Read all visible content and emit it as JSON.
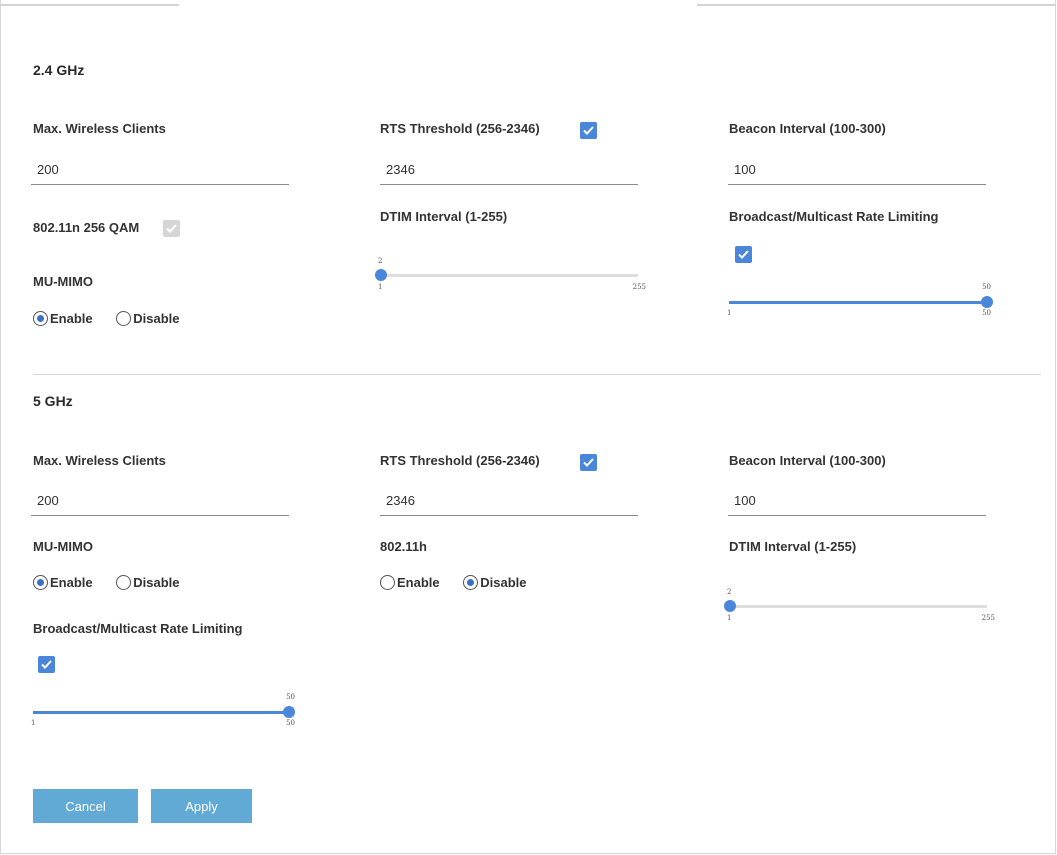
{
  "sections": {
    "ghz24": {
      "title": "2.4 GHz",
      "max_clients": {
        "label": "Max. Wireless Clients",
        "value": "200"
      },
      "rts": {
        "label": "RTS Threshold (256-2346)",
        "value": "2346",
        "checked": true
      },
      "beacon": {
        "label": "Beacon Interval (100-300)",
        "value": "100"
      },
      "qam": {
        "label": "802.11n 256 QAM",
        "checked": true,
        "disabled": true
      },
      "dtim": {
        "label": "DTIM Interval (1-255)",
        "value": "2",
        "min": "1",
        "max": "255"
      },
      "bm_rate": {
        "label": "Broadcast/Multicast Rate Limiting",
        "checked": true,
        "value": "50",
        "min": "1",
        "max": "50"
      },
      "mumimo": {
        "label": "MU-MIMO",
        "options": [
          "Enable",
          "Disable"
        ],
        "selected": "Enable"
      }
    },
    "ghz5": {
      "title": "5 GHz",
      "max_clients": {
        "label": "Max. Wireless Clients",
        "value": "200"
      },
      "rts": {
        "label": "RTS Threshold (256-2346)",
        "value": "2346",
        "checked": true
      },
      "beacon": {
        "label": "Beacon Interval (100-300)",
        "value": "100"
      },
      "mumimo": {
        "label": "MU-MIMO",
        "options": [
          "Enable",
          "Disable"
        ],
        "selected": "Enable"
      },
      "d80211h": {
        "label": "802.11h",
        "options": [
          "Enable",
          "Disable"
        ],
        "selected": "Disable"
      },
      "dtim": {
        "label": "DTIM Interval (1-255)",
        "value": "2",
        "min": "1",
        "max": "255"
      },
      "bm_rate": {
        "label": "Broadcast/Multicast Rate Limiting",
        "checked": true,
        "value": "50",
        "min": "1",
        "max": "50"
      }
    }
  },
  "buttons": {
    "cancel": "Cancel",
    "apply": "Apply"
  },
  "colors": {
    "accent": "#4a86d9",
    "button": "#62aad6",
    "checkbox_disabled": "#d6d6d6"
  },
  "icons": {
    "checkbox_mark": "check-icon"
  }
}
